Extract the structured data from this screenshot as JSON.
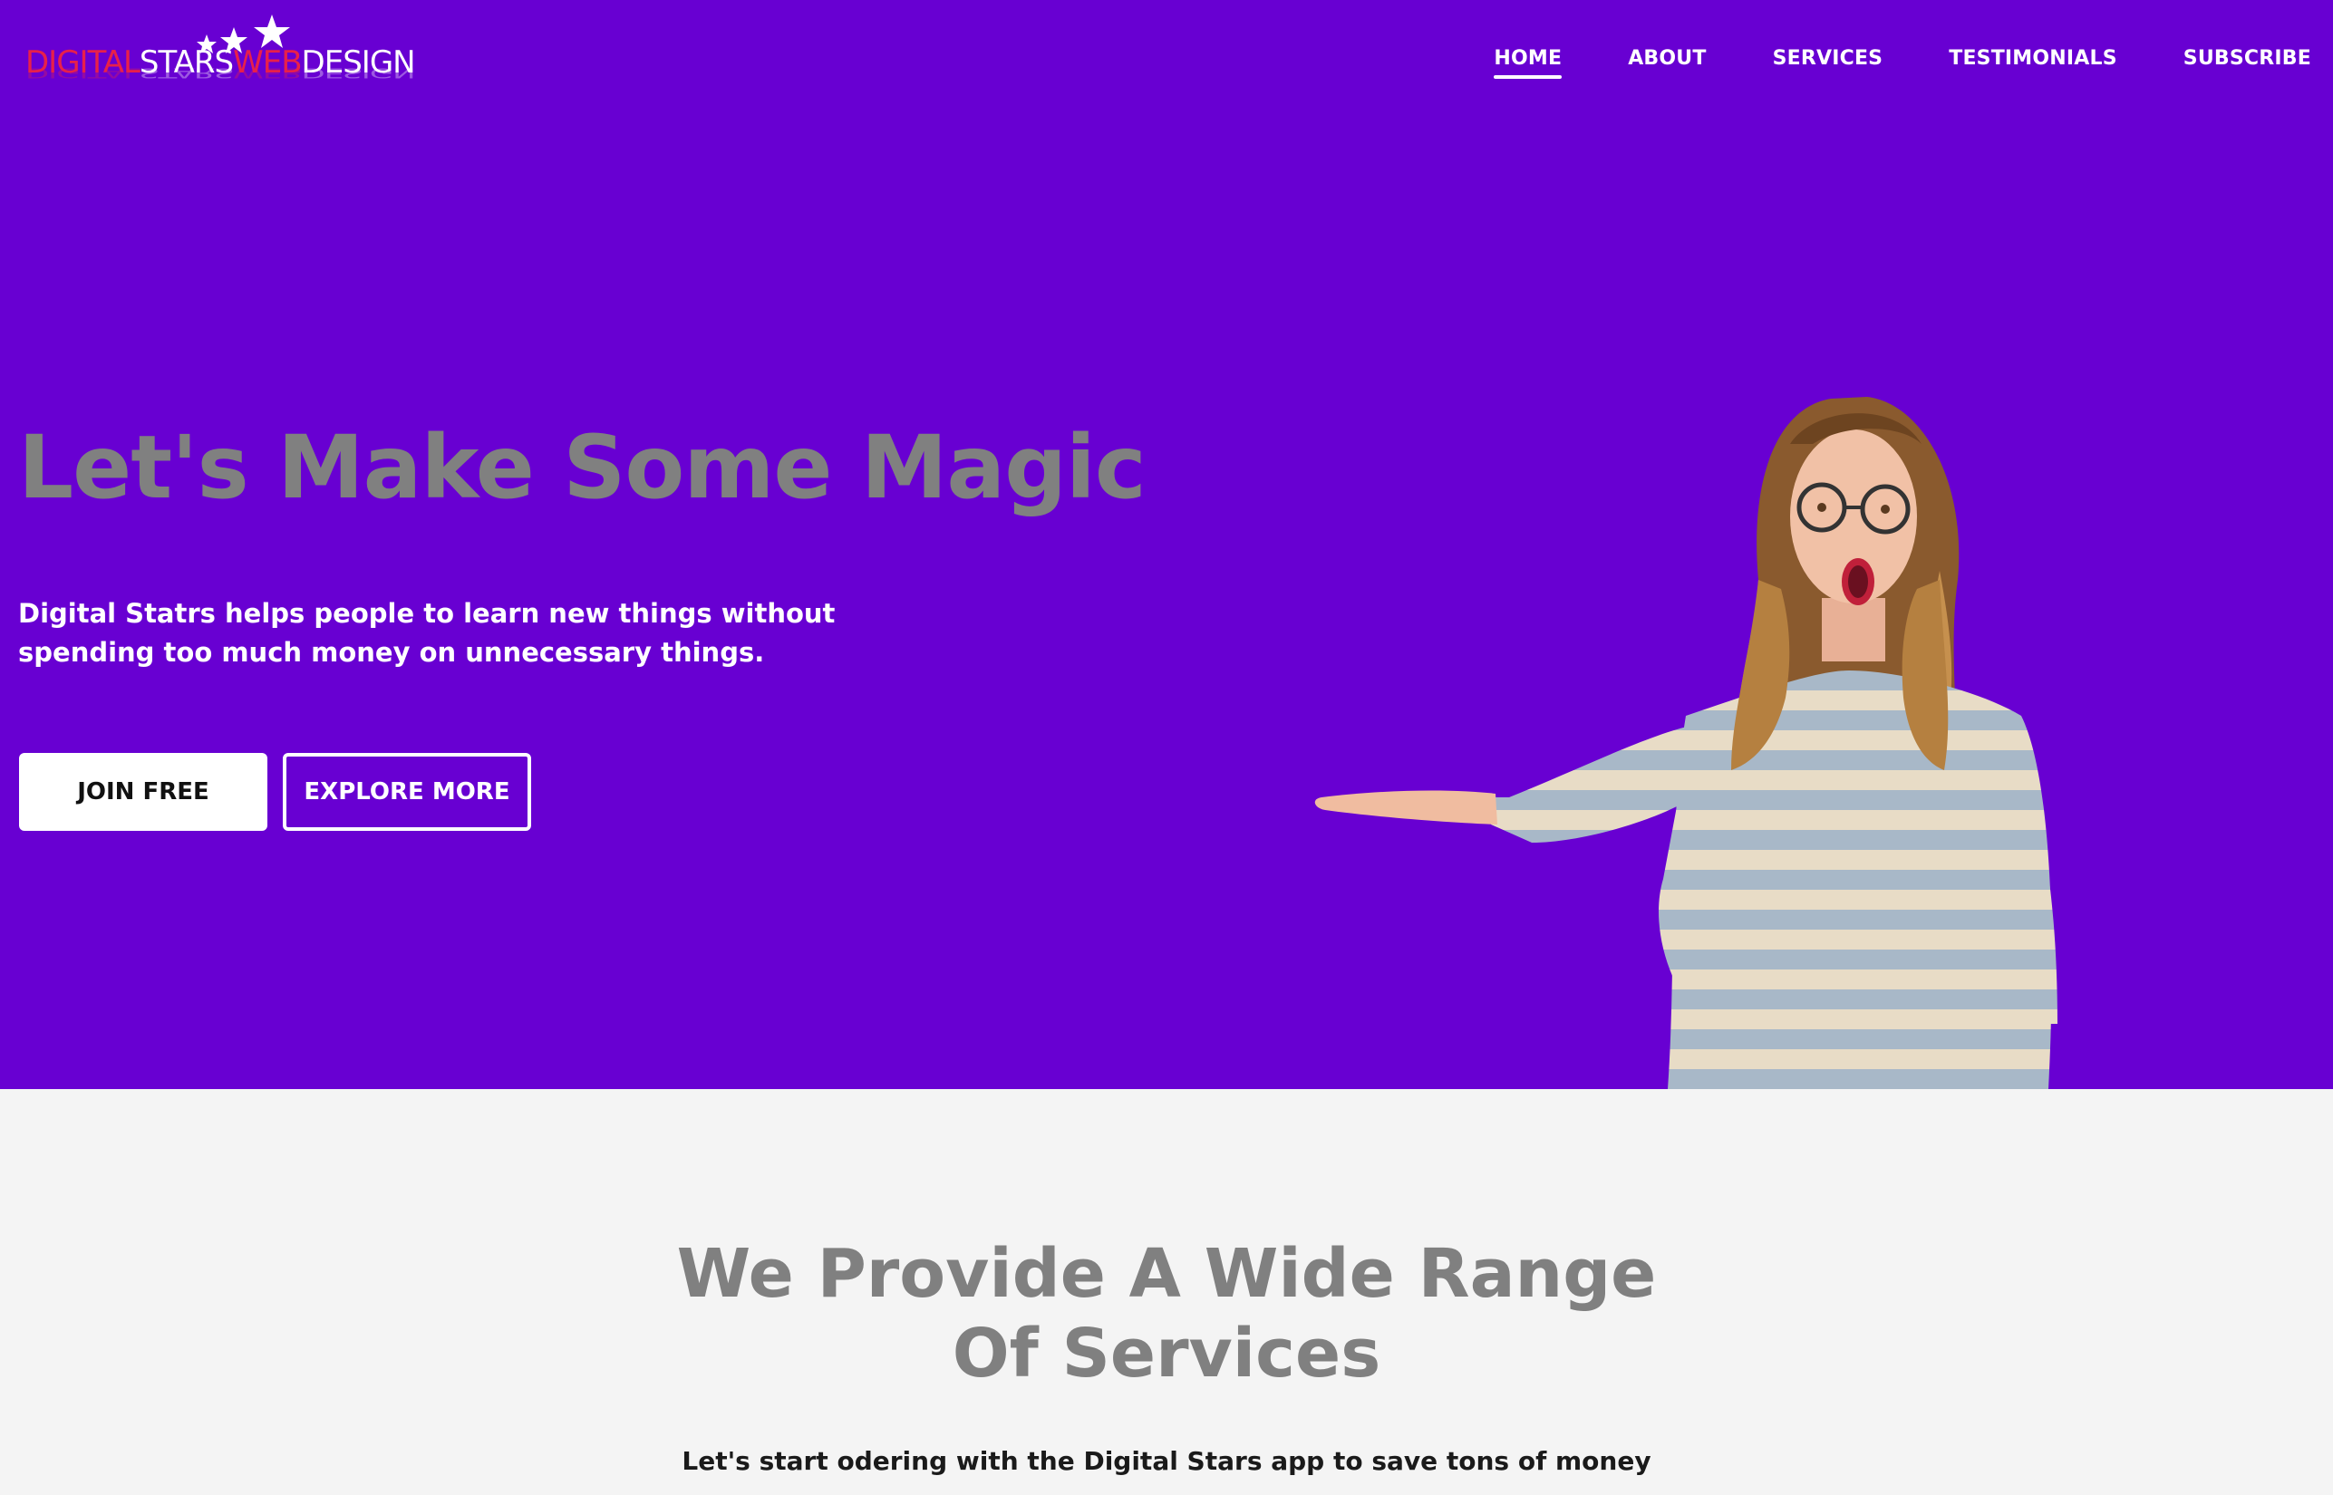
{
  "logo": {
    "part1": "DIGITAL",
    "part2": "STARS",
    "part3": "WEB",
    "part4": "DESIGN"
  },
  "nav": {
    "items": [
      {
        "label": "HOME",
        "active": true
      },
      {
        "label": "ABOUT",
        "active": false
      },
      {
        "label": "SERVICES",
        "active": false
      },
      {
        "label": "TESTIMONIALS",
        "active": false
      },
      {
        "label": "SUBSCRIBE",
        "active": false
      }
    ]
  },
  "hero": {
    "title": "Let's Make Some Magic",
    "subtitle": "Digital Statrs helps people to learn new things without spending too much money on unnecessary things.",
    "join_label": "JOIN FREE",
    "explore_label": "EXPLORE MORE"
  },
  "services": {
    "title_line1": "We Provide A Wide Range",
    "title_line2": "Of Services",
    "subtitle": "Let's start odering with the Digital Stars app to save tons of money"
  },
  "colors": {
    "hero_bg": "#6800d2",
    "title_gray": "#808080",
    "logo_red": "#e8204a",
    "section_bg": "#f4f4f4"
  }
}
